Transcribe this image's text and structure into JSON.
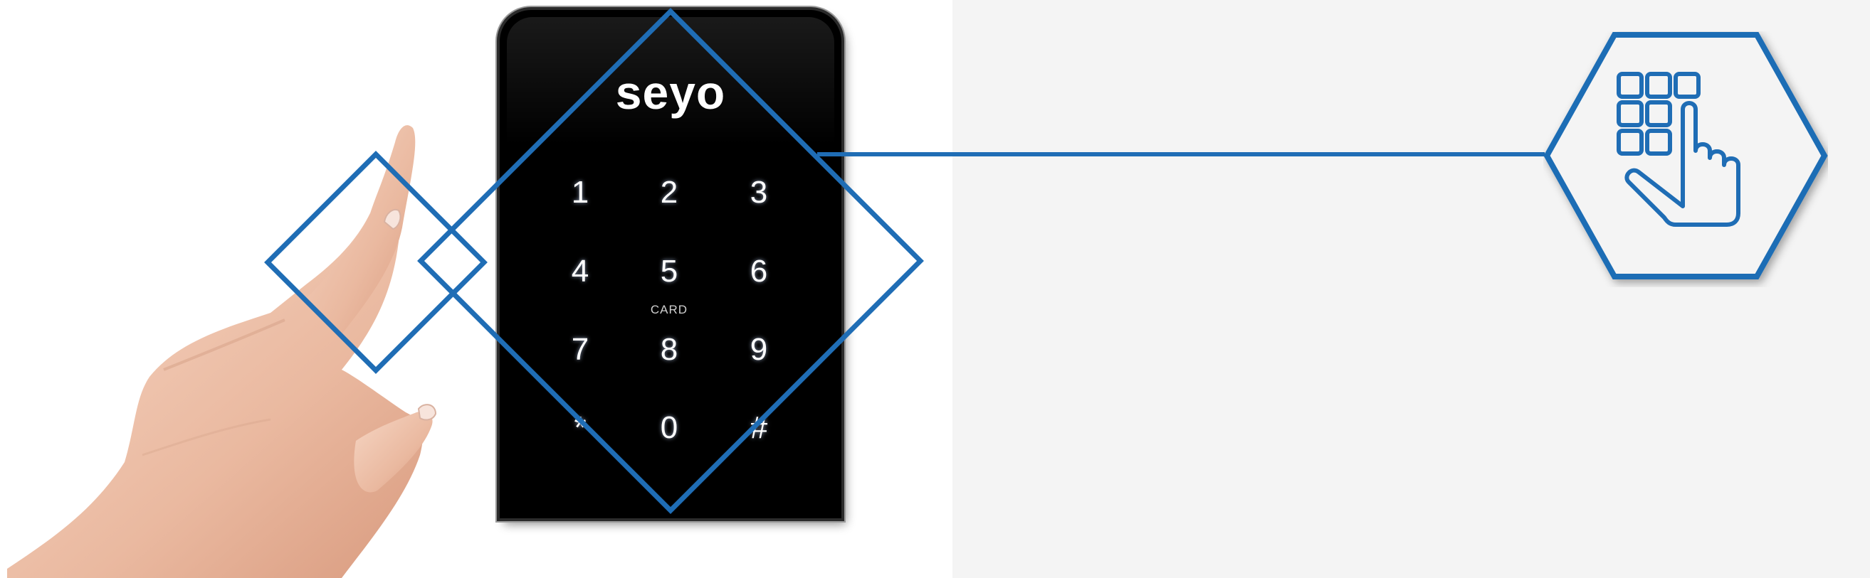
{
  "brand": "seyo",
  "keypad": {
    "keys": [
      "1",
      "2",
      "3",
      "4",
      "5",
      "6",
      "7",
      "8",
      "9",
      "*",
      "0",
      "#"
    ],
    "card_label": "CARD"
  },
  "colors": {
    "accent": "#1f6db5",
    "right_panel_background": "#f4f4f4",
    "device_body": "#000000",
    "key_text": "#ffffff"
  },
  "icons": {
    "feature_icon": "keypad-touch-icon"
  }
}
